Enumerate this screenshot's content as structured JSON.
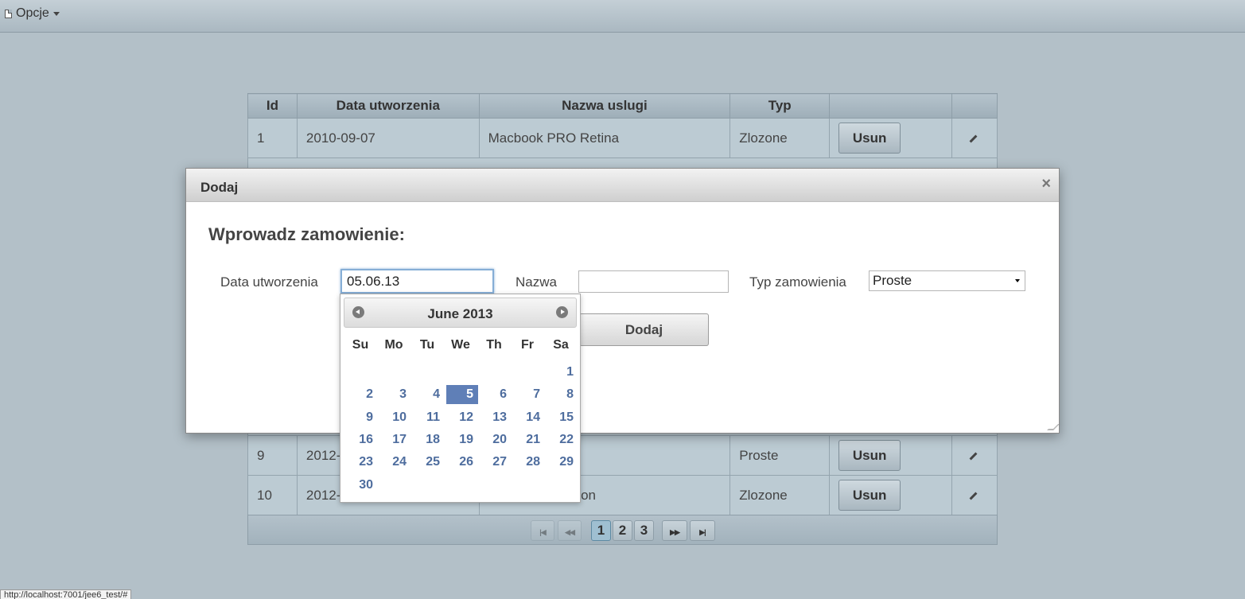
{
  "menubar": {
    "opcje_label": "Opcje"
  },
  "table": {
    "headers": [
      "Id",
      "Data utworzenia",
      "Nazwa uslugi",
      "Typ"
    ],
    "rows": [
      {
        "id": "1",
        "date": "2010-09-07",
        "name": "Macbook PRO Retina",
        "type": "Zlozone",
        "action": "Usun"
      },
      {
        "id": "9",
        "date": "2012-",
        "name": "",
        "type": "Proste",
        "action": "Usun"
      },
      {
        "id": "10",
        "date": "2012-",
        "name": "bon",
        "type": "Zlozone",
        "action": "Usun"
      }
    ]
  },
  "pager": {
    "pages": [
      "1",
      "2",
      "3"
    ],
    "active_page": "1"
  },
  "dialog": {
    "title": "Dodaj",
    "close": "×",
    "heading": "Wprowadz zamowienie:",
    "date_label": "Data utworzenia",
    "date_value": "05.06.13",
    "name_label": "Nazwa",
    "name_value": "",
    "type_label": "Typ zamowienia",
    "type_selected": "Proste",
    "submit_label": "Dodaj"
  },
  "datepicker": {
    "title": "June 2013",
    "weekdays": [
      "Su",
      "Mo",
      "Tu",
      "We",
      "Th",
      "Fr",
      "Sa"
    ],
    "days": [
      "1",
      "2",
      "3",
      "4",
      "5",
      "6",
      "7",
      "8",
      "9",
      "10",
      "11",
      "12",
      "13",
      "14",
      "15",
      "16",
      "17",
      "18",
      "19",
      "20",
      "21",
      "22",
      "23",
      "24",
      "25",
      "26",
      "27",
      "28",
      "29",
      "30"
    ],
    "selected_day": "5"
  },
  "statusbar": {
    "url": "http://localhost:7001/jee6_test/#"
  }
}
